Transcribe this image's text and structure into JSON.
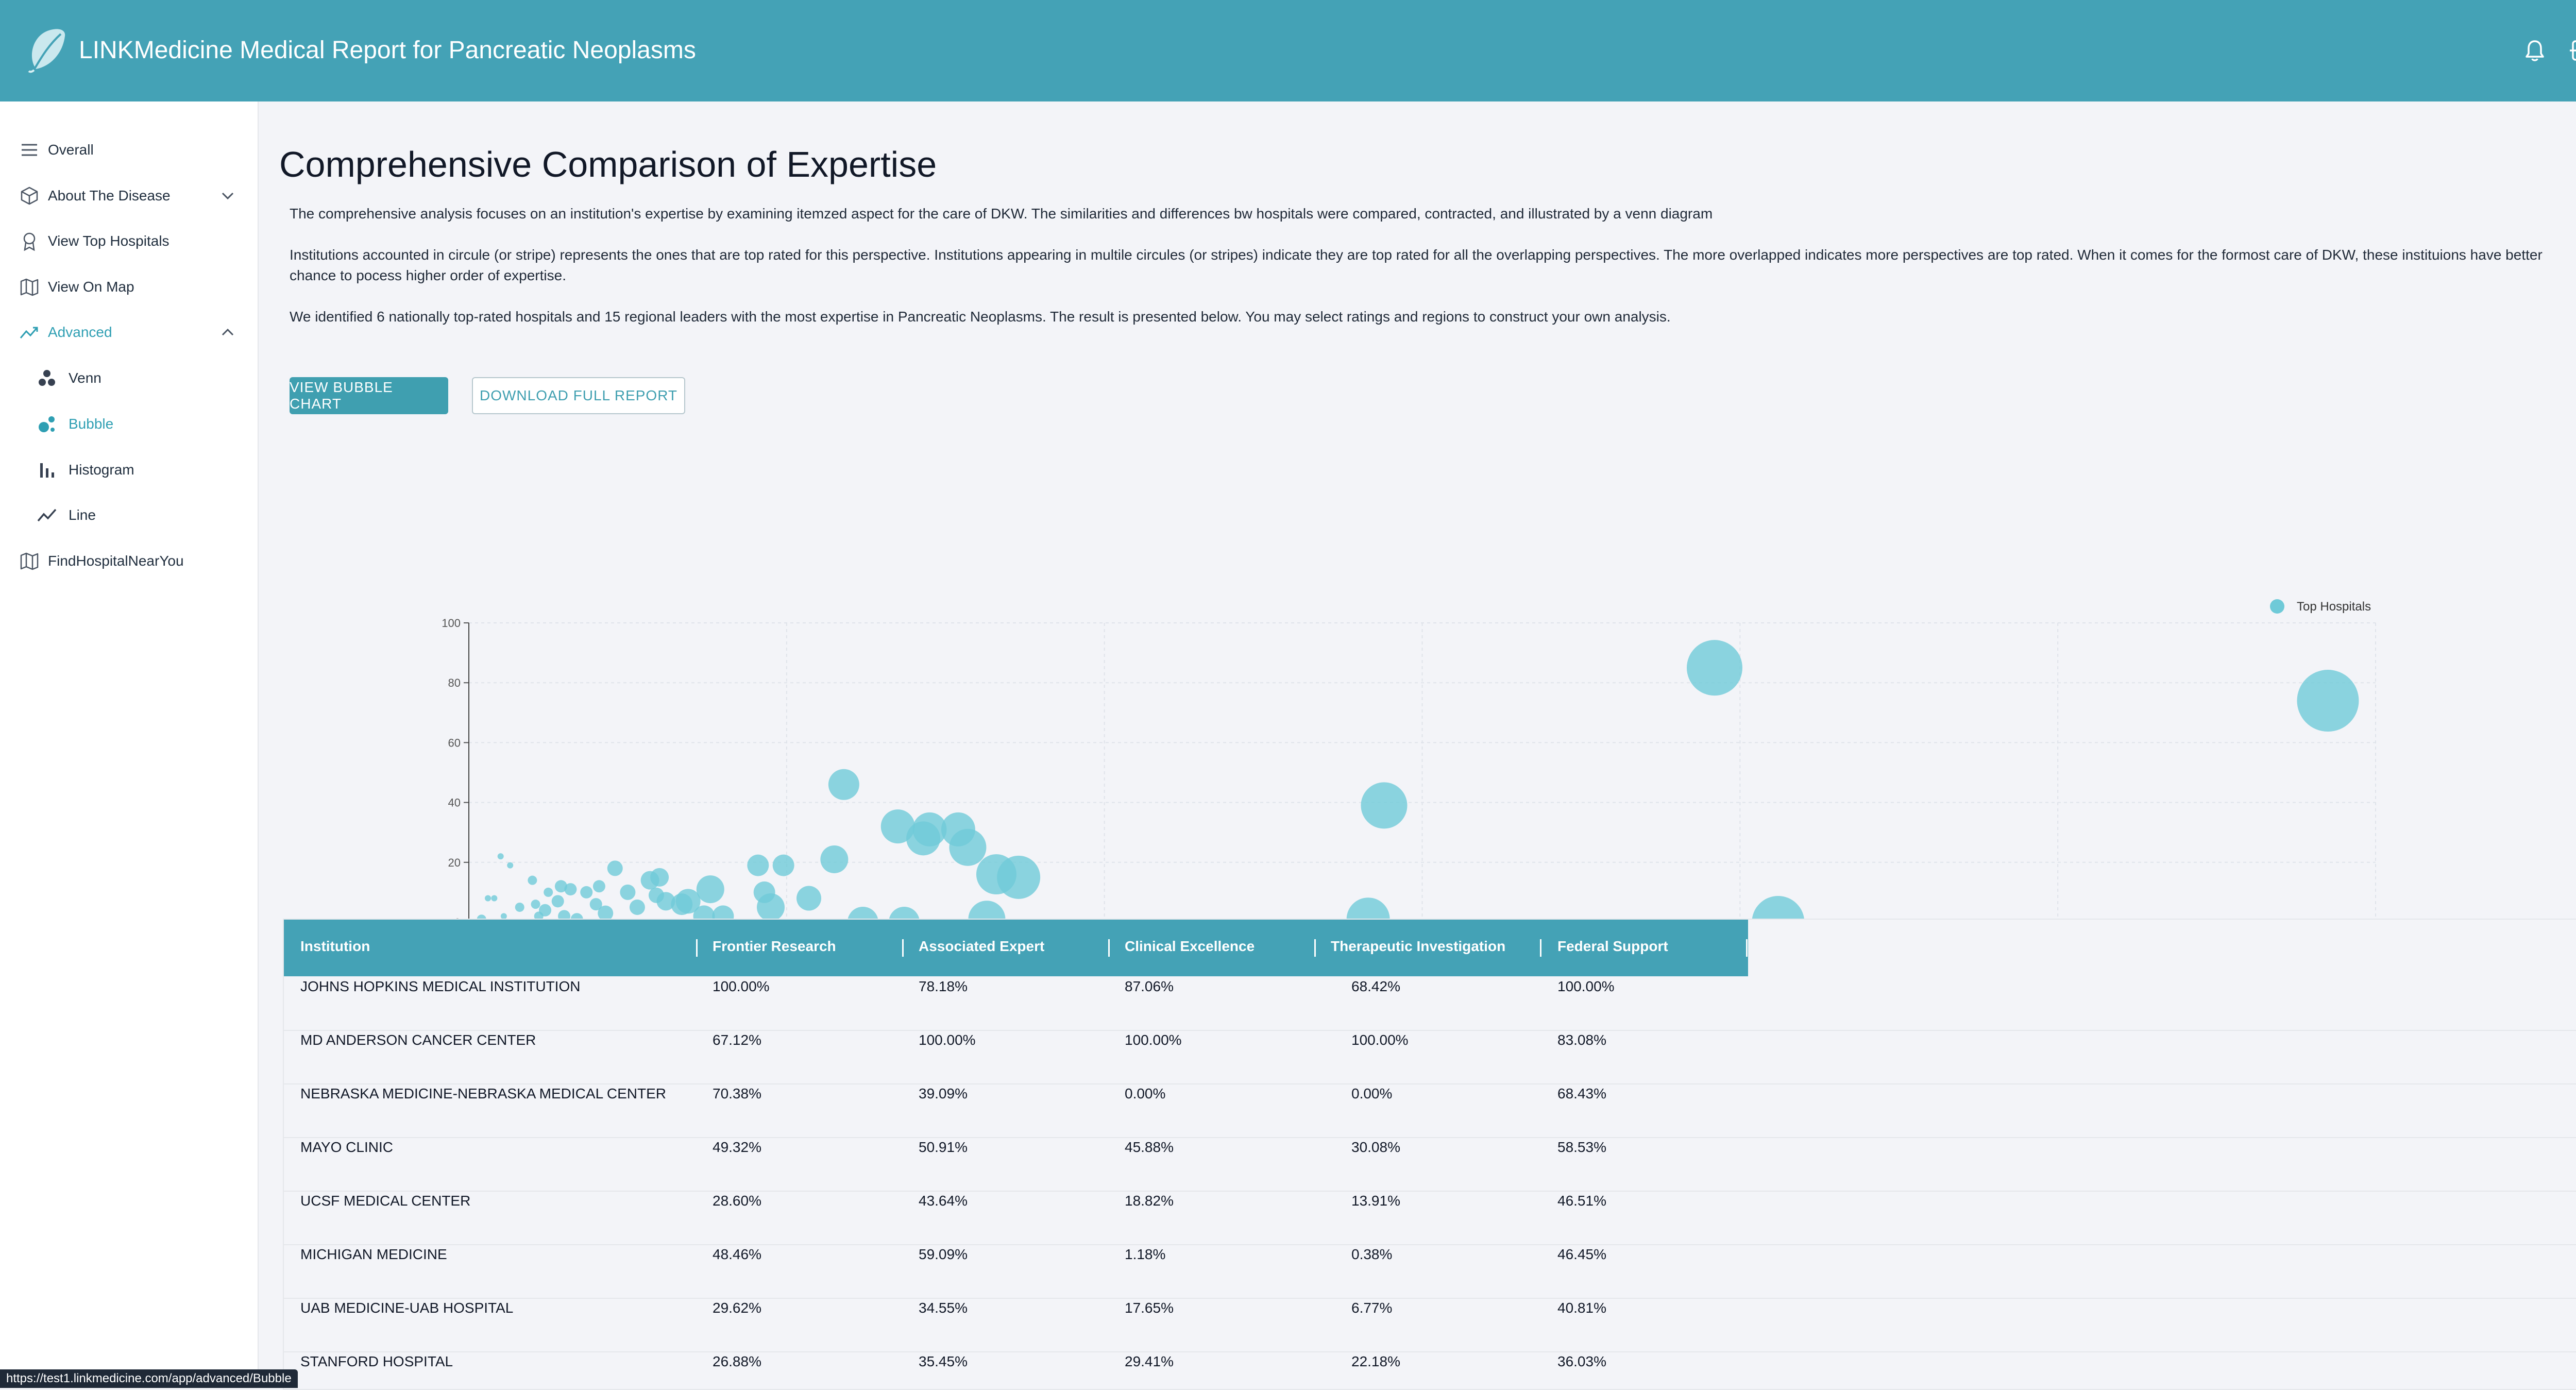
{
  "header": {
    "title": "LINKMedicine Medical Report for Pancreatic Neoplasms",
    "icons": [
      "leaf-logo-icon",
      "bell-icon",
      "logout-icon"
    ]
  },
  "sidebar": {
    "items": [
      {
        "label": "Overall",
        "icon": "list-icon"
      },
      {
        "label": "About The Disease",
        "icon": "cube-icon",
        "expandable": true
      },
      {
        "label": "View Top Hospitals",
        "icon": "award-icon"
      },
      {
        "label": "View On Map",
        "icon": "map-icon"
      },
      {
        "label": "Advanced",
        "icon": "trend-icon",
        "expanded": true
      },
      {
        "label": "Venn",
        "icon": "venn-icon"
      },
      {
        "label": "Bubble",
        "icon": "bubble-icon",
        "active": true
      },
      {
        "label": "Histogram",
        "icon": "bar-chart-icon"
      },
      {
        "label": "Line",
        "icon": "line-chart-icon"
      },
      {
        "label": "FindHospitalNearYou",
        "icon": "map-icon"
      }
    ]
  },
  "main": {
    "title": "Comprehensive Comparison of Expertise",
    "paragraphs": [
      "The comprehensive analysis focuses on an institution's expertise by examining itemzed aspect for the care of DKW. The similarities and differences bw hospitals were compared, contracted, and illustrated by a venn diagram",
      "Institutions accounted in circule (or stripe) represents the ones that are top rated for this perspective. Institutions appearing in multile circules (or stripes) indicate they are top rated for all the overlapping perspectives. The more overlapped indicates more perspectives are top rated. When it comes for the formost care of DKW, these instituions have better chance to pocess higher order of expertise.",
      "We identified 6 nationally top-rated hospitals and 15 regional leaders with the most expertise in Pancreatic Neoplasms. The result is presented below. You may select ratings and regions to construct your own analysis."
    ],
    "buttons": {
      "bubble": "VIEW BUBBLE CHART",
      "download": "DOWNLOAD FULL REPORT"
    }
  },
  "chart_data": {
    "type": "scatter",
    "legend": "Top Hospitals",
    "legend_position": "top-right",
    "color": "#6fcad8",
    "xlim": [
      0,
      600
    ],
    "ylim": [
      0,
      100
    ],
    "x_ticks": [
      "0",
      "100",
      "200",
      "300",
      "400",
      "500",
      "600"
    ],
    "y_ticks": [
      "0",
      "20",
      "40",
      "60",
      "80",
      "100"
    ],
    "grid": true,
    "points": [
      {
        "x": 585,
        "y": 74,
        "size": 20
      },
      {
        "x": 392,
        "y": 85,
        "size": 18
      },
      {
        "x": 412,
        "y": 0,
        "size": 17
      },
      {
        "x": 288,
        "y": 39,
        "size": 15
      },
      {
        "x": 283,
        "y": 1,
        "size": 14
      },
      {
        "x": 173,
        "y": 15,
        "size": 14
      },
      {
        "x": 166,
        "y": 16,
        "size": 13
      },
      {
        "x": 163,
        "y": 1,
        "size": 12
      },
      {
        "x": 157,
        "y": 25,
        "size": 12
      },
      {
        "x": 154,
        "y": 31,
        "size": 11
      },
      {
        "x": 145,
        "y": 31,
        "size": 11
      },
      {
        "x": 143,
        "y": 28,
        "size": 11
      },
      {
        "x": 135,
        "y": 32,
        "size": 11
      },
      {
        "x": 137,
        "y": 0,
        "size": 10
      },
      {
        "x": 124,
        "y": 0,
        "size": 10
      },
      {
        "x": 118,
        "y": 46,
        "size": 10
      },
      {
        "x": 115,
        "y": 21,
        "size": 9
      },
      {
        "x": 107,
        "y": 8,
        "size": 8
      },
      {
        "x": 99,
        "y": 19,
        "size": 7
      },
      {
        "x": 95,
        "y": 5,
        "size": 9
      },
      {
        "x": 93,
        "y": 10,
        "size": 7
      },
      {
        "x": 91,
        "y": 19,
        "size": 7
      },
      {
        "x": 80,
        "y": 2,
        "size": 7
      },
      {
        "x": 76,
        "y": 11,
        "size": 9
      },
      {
        "x": 74,
        "y": 2,
        "size": 7
      },
      {
        "x": 69,
        "y": 7,
        "size": 8
      },
      {
        "x": 67,
        "y": 6,
        "size": 7
      },
      {
        "x": 62,
        "y": 7,
        "size": 6
      },
      {
        "x": 60,
        "y": 15,
        "size": 6
      },
      {
        "x": 59,
        "y": 9,
        "size": 5
      },
      {
        "x": 57,
        "y": 14,
        "size": 6
      },
      {
        "x": 53,
        "y": 5,
        "size": 5
      },
      {
        "x": 50,
        "y": 10,
        "size": 5
      },
      {
        "x": 46,
        "y": 18,
        "size": 5
      },
      {
        "x": 43,
        "y": 3,
        "size": 5
      },
      {
        "x": 41,
        "y": 12,
        "size": 4
      },
      {
        "x": 40,
        "y": 6,
        "size": 4
      },
      {
        "x": 37,
        "y": 10,
        "size": 4
      },
      {
        "x": 34,
        "y": 1,
        "size": 4
      },
      {
        "x": 32,
        "y": 11,
        "size": 4
      },
      {
        "x": 30,
        "y": 2,
        "size": 4
      },
      {
        "x": 29,
        "y": 12,
        "size": 4
      },
      {
        "x": 28,
        "y": 7,
        "size": 4
      },
      {
        "x": 25,
        "y": 10,
        "size": 3
      },
      {
        "x": 24,
        "y": 4,
        "size": 4
      },
      {
        "x": 22,
        "y": 2,
        "size": 3
      },
      {
        "x": 21,
        "y": 6,
        "size": 3
      },
      {
        "x": 20,
        "y": 14,
        "size": 3
      },
      {
        "x": 16,
        "y": 5,
        "size": 3
      },
      {
        "x": 13,
        "y": 19,
        "size": 2
      },
      {
        "x": 11,
        "y": 2,
        "size": 2
      },
      {
        "x": 10,
        "y": 22,
        "size": 2
      },
      {
        "x": 8,
        "y": 8,
        "size": 2
      },
      {
        "x": 6,
        "y": 8,
        "size": 2
      },
      {
        "x": 4,
        "y": 1,
        "size": 3
      },
      {
        "x": 2,
        "y": 0,
        "size": 2
      }
    ]
  },
  "table": {
    "columns": [
      "Institution",
      "Frontier Research",
      "Associated Expert",
      "Clinical Excellence",
      "Therapeutic Investigation",
      "Federal Support"
    ],
    "rows": [
      [
        "JOHNS HOPKINS MEDICAL INSTITUTION",
        "100.00%",
        "78.18%",
        "87.06%",
        "68.42%",
        "100.00%"
      ],
      [
        "MD ANDERSON CANCER CENTER",
        "67.12%",
        "100.00%",
        "100.00%",
        "100.00%",
        "83.08%"
      ],
      [
        "NEBRASKA MEDICINE-NEBRASKA MEDICAL CENTER",
        "70.38%",
        "39.09%",
        "0.00%",
        "0.00%",
        "68.43%"
      ],
      [
        "MAYO CLINIC",
        "49.32%",
        "50.91%",
        "45.88%",
        "30.08%",
        "58.53%"
      ],
      [
        "UCSF MEDICAL CENTER",
        "28.60%",
        "43.64%",
        "18.82%",
        "13.91%",
        "46.51%"
      ],
      [
        "MICHIGAN MEDICINE",
        "48.46%",
        "59.09%",
        "1.18%",
        "0.38%",
        "46.45%"
      ],
      [
        "UAB MEDICINE-UAB HOSPITAL",
        "29.62%",
        "34.55%",
        "17.65%",
        "6.77%",
        "40.81%"
      ],
      [
        "STANFORD HOSPITAL",
        "26.88%",
        "35.45%",
        "29.41%",
        "22.18%",
        "36.03%"
      ]
    ]
  },
  "status_bar": {
    "url": "https://test1.linkmedicine.com/app/advanced/Bubble"
  }
}
